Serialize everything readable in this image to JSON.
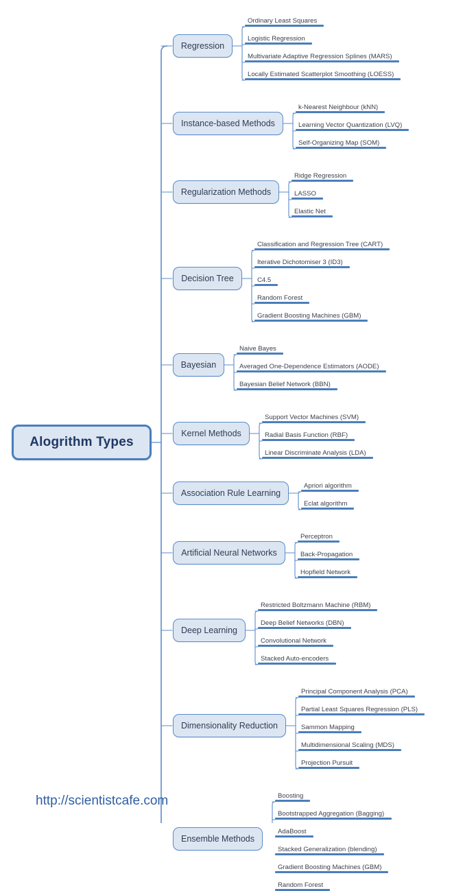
{
  "diagram": {
    "title": "Alogrithm Types",
    "type": "mind-map",
    "colors": {
      "node_fill": "#DCE6F2",
      "node_border": "#5B8BC9",
      "root_border": "#4A7EBB",
      "leaf_bar": "#4A7EBB",
      "link_line": "#5B8BC9",
      "root_text": "#1F3864",
      "branch_text": "#2F3B52",
      "leaf_text": "#3A3F4B",
      "url_text": "#2E5FA3",
      "background": "#FFFFFF"
    }
  },
  "root": {
    "label": "Alogrithm Types"
  },
  "branches": [
    {
      "label": "Regression",
      "leaves": [
        "Ordinary Least Squares",
        "Logistic Regression",
        "Multivariate Adaptive Regression Splines (MARS)",
        "Locally Estimated Scatterplot Smoothing (LOESS)"
      ]
    },
    {
      "label": "Instance-based Methods",
      "leaves": [
        "k-Nearest Neighbour (kNN)",
        "Learning Vector Quantization (LVQ)",
        "Self-Organizing Map (SOM)"
      ]
    },
    {
      "label": "Regularization Methods",
      "leaves": [
        "Ridge Regression",
        "LASSO",
        "Elastic Net"
      ]
    },
    {
      "label": "Decision Tree",
      "leaves": [
        "Classification and Regression Tree (CART)",
        "Iterative Dichotomiser 3 (ID3)",
        "C4.5",
        "Random Forest",
        "Gradient Boosting Machines (GBM)"
      ]
    },
    {
      "label": "Bayesian",
      "leaves": [
        "Naive Bayes",
        "Averaged One-Dependence Estimators (AODE)",
        "Bayesian Belief Network (BBN)"
      ]
    },
    {
      "label": "Kernel Methods",
      "leaves": [
        "Support Vector Machines (SVM)",
        "Radial Basis Function (RBF)",
        "Linear Discriminate Analysis (LDA)"
      ]
    },
    {
      "label": "Association Rule Learning",
      "leaves": [
        "Apriori algorithm",
        "Eclat algorithm"
      ]
    },
    {
      "label": "Artificial Neural Networks",
      "leaves": [
        "Perceptron",
        "Back-Propagation",
        "Hopfield Network"
      ]
    },
    {
      "label": "Deep Learning",
      "leaves": [
        "Restricted Boltzmann Machine (RBM)",
        "Deep Belief Networks (DBN)",
        "Convolutional Network",
        "Stacked Auto-encoders"
      ]
    },
    {
      "label": "Dimensionality Reduction",
      "leaves": [
        "Principal Component Analysis (PCA)",
        "Partial Least Squares Regression (PLS)",
        "Sammon Mapping",
        "Multidimensional Scaling (MDS)",
        "Projection Pursuit"
      ]
    },
    {
      "label": "Ensemble Methods",
      "leaves": [
        "Boosting",
        "Bootstrapped Aggregation (Bagging)",
        "AdaBoost",
        "Stacked Generalization (blending)",
        "Gradient Boosting Machines (GBM)",
        "Random Forest"
      ]
    }
  ],
  "footer": {
    "url": "http://scientistcafe.com"
  }
}
